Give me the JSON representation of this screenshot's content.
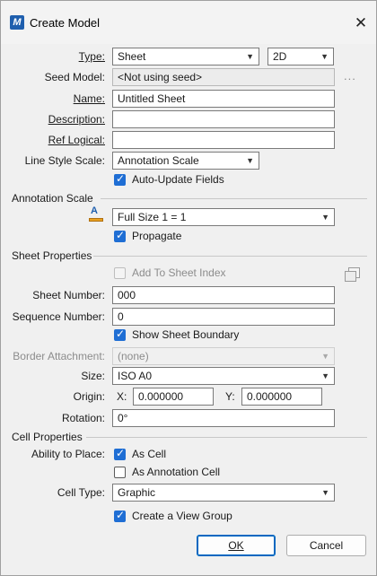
{
  "window": {
    "title": "Create Model",
    "close_symbol": "✕"
  },
  "type": {
    "label": "Type:",
    "value": "Sheet",
    "dimension": "2D"
  },
  "seed_model": {
    "label": "Seed Model:",
    "value": "<Not using seed>",
    "browse": "..."
  },
  "name": {
    "label": "Name:",
    "value": "Untitled Sheet"
  },
  "description": {
    "label": "Description:",
    "value": ""
  },
  "ref_logical": {
    "label": "Ref Logical:",
    "value": ""
  },
  "line_style_scale": {
    "label": "Line Style Scale:",
    "value": "Annotation Scale"
  },
  "auto_update": {
    "label": "Auto-Update Fields",
    "checked": true
  },
  "annotation_scale": {
    "section": "Annotation Scale",
    "icon": "annotation-scale-icon",
    "value": "Full Size 1 = 1",
    "propagate": {
      "label": "Propagate",
      "checked": true
    }
  },
  "sheet_properties": {
    "section": "Sheet Properties",
    "add_to_index": {
      "label": "Add To Sheet Index",
      "checked": false,
      "enabled": false
    },
    "sheet_number": {
      "label": "Sheet Number:",
      "value": "000"
    },
    "sequence_number": {
      "label": "Sequence Number:",
      "value": "0"
    },
    "show_boundary": {
      "label": "Show Sheet Boundary",
      "checked": true
    },
    "border_attachment": {
      "label": "Border Attachment:",
      "value": "(none)",
      "enabled": false
    },
    "size": {
      "label": "Size:",
      "value": "ISO A0"
    },
    "origin": {
      "label": "Origin:",
      "x_label": "X:",
      "x": "0.000000",
      "y_label": "Y:",
      "y": "0.000000"
    },
    "rotation": {
      "label": "Rotation:",
      "value": "0°"
    }
  },
  "cell_properties": {
    "section": "Cell Properties",
    "ability_label": "Ability to Place:",
    "as_cell": {
      "label": "As Cell",
      "checked": true
    },
    "as_annotation_cell": {
      "label": "As Annotation Cell",
      "checked": false
    },
    "cell_type": {
      "label": "Cell Type:",
      "value": "Graphic"
    },
    "create_view_group": {
      "label": "Create a View Group",
      "checked": true
    }
  },
  "buttons": {
    "ok": "OK",
    "cancel": "Cancel"
  },
  "colors": {
    "accent": "#1f6ed4",
    "primary_border": "#0067c0"
  }
}
